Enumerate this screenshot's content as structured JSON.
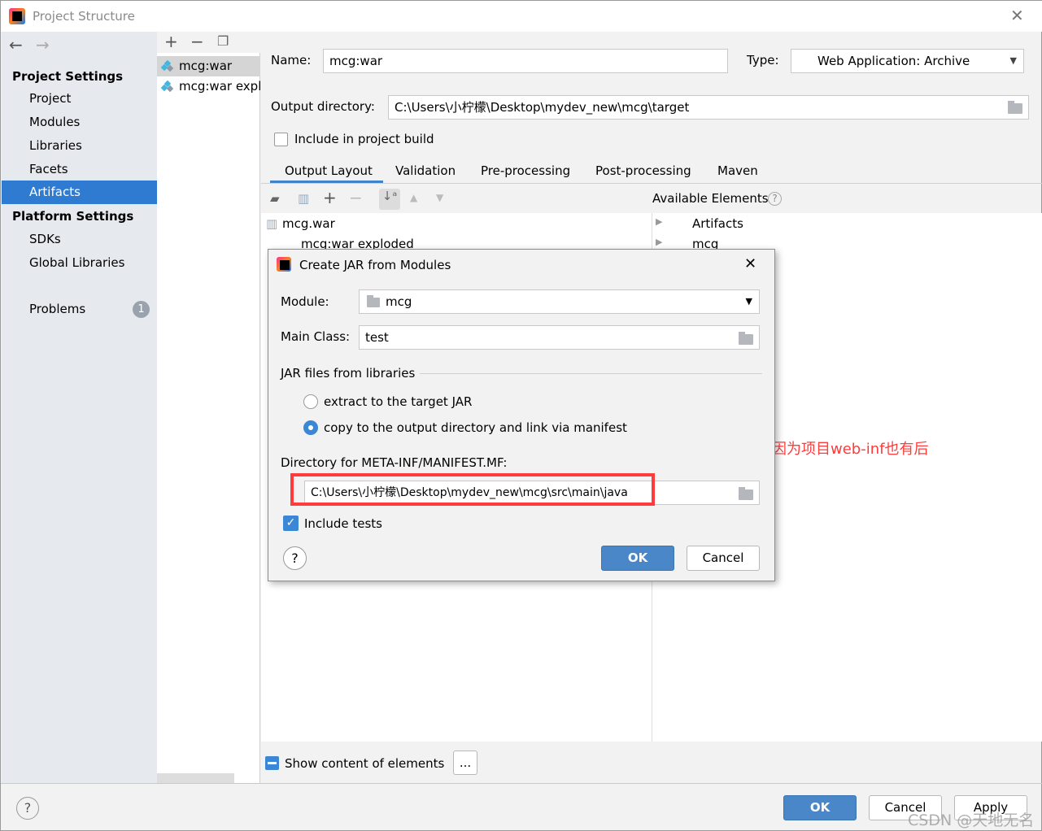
{
  "window": {
    "title": "Project Structure"
  },
  "sidebar": {
    "sections": [
      {
        "label": "Project Settings",
        "items": [
          "Project",
          "Modules",
          "Libraries",
          "Facets",
          "Artifacts"
        ]
      },
      {
        "label": "Platform Settings",
        "items": [
          "SDKs",
          "Global Libraries"
        ]
      }
    ],
    "selected": "Artifacts",
    "problems_label": "Problems",
    "problems_count": "1"
  },
  "artifacts": {
    "items": [
      "mcg:war",
      "mcg:war expl"
    ]
  },
  "form": {
    "name_label": "Name:",
    "name_value": "mcg:war",
    "type_label": "Type:",
    "type_value": "Web Application: Archive",
    "output_label": "Output directory:",
    "output_value": "C:\\Users\\小柠檬\\Desktop\\mydev_new\\mcg\\target",
    "include_build_label": "Include in project build",
    "include_build_checked": false
  },
  "tabs": [
    "Output Layout",
    "Validation",
    "Pre-processing",
    "Post-processing",
    "Maven"
  ],
  "active_tab": "Output Layout",
  "layout": {
    "tree": [
      "mcg.war",
      "mcg:war exploded"
    ],
    "available_label": "Available Elements",
    "available": [
      "Artifacts",
      "mcg"
    ],
    "show_content_label": "Show content of elements",
    "more_label": "..."
  },
  "dialog": {
    "title": "Create JAR from Modules",
    "module_label": "Module:",
    "module_value": "mcg",
    "main_class_label": "Main Class:",
    "main_class_value": "test",
    "jar_section": "JAR files from libraries",
    "option_extract": "extract to the target JAR",
    "option_copy": "copy to the output directory and link via manifest",
    "selected_option": "copy",
    "manifest_label": "Directory for META-INF/MANIFEST.MF:",
    "manifest_value": "C:\\Users\\小柠檬\\Desktop\\mydev_new\\mcg\\src\\main\\java",
    "include_tests_label": "Include tests",
    "include_tests_checked": true,
    "ok": "OK",
    "cancel": "Cancel"
  },
  "annotation": {
    "text": "切记换个位置，因为项目web-inf也有后",
    "color": "#ff3b3b"
  },
  "footer": {
    "ok": "OK",
    "cancel": "Cancel",
    "apply": "Apply"
  },
  "watermark": "CSDN @天地无名"
}
